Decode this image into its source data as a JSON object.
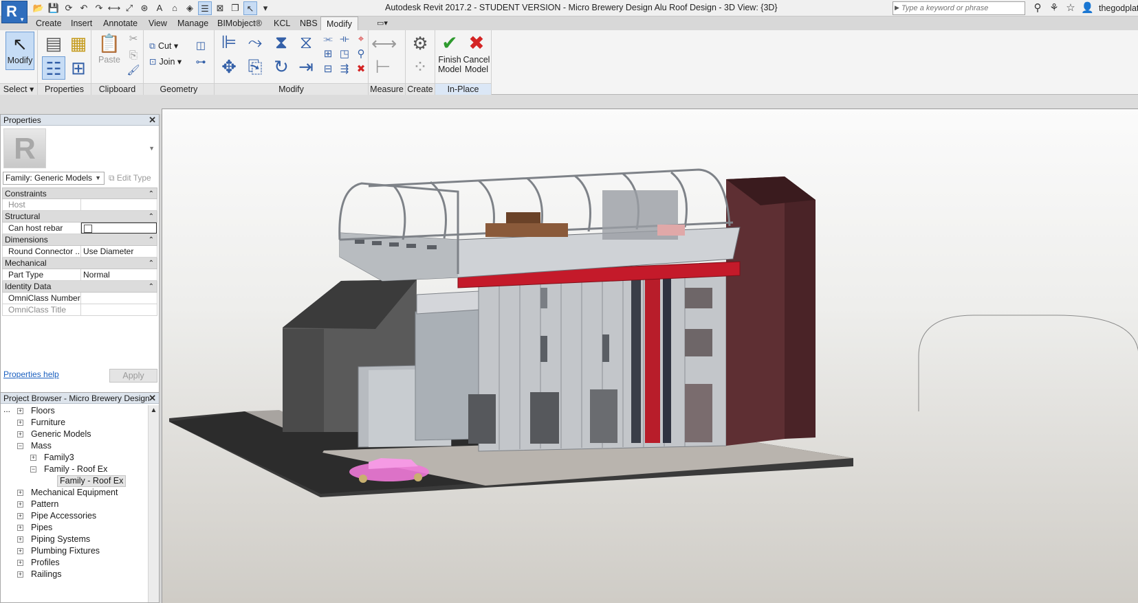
{
  "app": {
    "logo_letter": "R",
    "window_title": "Autodesk Revit 2017.2 - STUDENT VERSION -    Micro Brewery Design Alu Roof Design - 3D View: {3D}",
    "search_placeholder": "Type a keyword or phrase",
    "username": "thegodplato"
  },
  "ribbon": {
    "tabs": [
      "Create",
      "Insert",
      "Annotate",
      "View",
      "Manage",
      "BIMobject®",
      "KCL",
      "NBS",
      "Modify"
    ],
    "active_tab": "Modify",
    "panels": {
      "select": "Select",
      "properties": "Properties",
      "clipboard": "Clipboard",
      "geometry": "Geometry",
      "modify": "Modify",
      "measure": "Measure",
      "create": "Create",
      "inplace": "In-Place Editor"
    },
    "buttons": {
      "modify": "Modify",
      "paste": "Paste",
      "cut": "Cut",
      "join": "Join",
      "finish_model_1": "Finish",
      "finish_model_2": "Model",
      "cancel_model_1": "Cancel",
      "cancel_model_2": "Model"
    }
  },
  "properties": {
    "title": "Properties",
    "type_thumb_letter": "R",
    "family_selector": "Family: Generic Models",
    "edit_type": "Edit Type",
    "categories": [
      {
        "name": "Constraints",
        "rows": [
          {
            "key": "Host",
            "value": "",
            "disabled": true
          }
        ]
      },
      {
        "name": "Structural",
        "rows": [
          {
            "key": "Can host rebar",
            "value": "",
            "checkbox": true
          }
        ]
      },
      {
        "name": "Dimensions",
        "rows": [
          {
            "key": "Round Connector ...",
            "value": "Use Diameter"
          }
        ]
      },
      {
        "name": "Mechanical",
        "rows": [
          {
            "key": "Part Type",
            "value": "Normal"
          }
        ]
      },
      {
        "name": "Identity Data",
        "rows": [
          {
            "key": "OmniClass Number",
            "value": ""
          },
          {
            "key": "OmniClass Title",
            "value": "",
            "disabled": true
          }
        ]
      }
    ],
    "help_link": "Properties help",
    "apply": "Apply"
  },
  "browser": {
    "title": "Project Browser - Micro Brewery Design ...",
    "items": [
      {
        "label": "Floors",
        "level": 0,
        "toggle": "+"
      },
      {
        "label": "Furniture",
        "level": 0,
        "toggle": "+"
      },
      {
        "label": "Generic Models",
        "level": 0,
        "toggle": "+"
      },
      {
        "label": "Mass",
        "level": 0,
        "toggle": "-"
      },
      {
        "label": "Family3",
        "level": 1,
        "toggle": "+"
      },
      {
        "label": "Family - Roof Ex",
        "level": 1,
        "toggle": "-"
      },
      {
        "label": "Family - Roof Ex",
        "level": 2,
        "toggle": "",
        "selected": true
      },
      {
        "label": "Mechanical Equipment",
        "level": 0,
        "toggle": "+"
      },
      {
        "label": "Pattern",
        "level": 0,
        "toggle": "+"
      },
      {
        "label": "Pipe Accessories",
        "level": 0,
        "toggle": "+"
      },
      {
        "label": "Pipes",
        "level": 0,
        "toggle": "+"
      },
      {
        "label": "Piping Systems",
        "level": 0,
        "toggle": "+"
      },
      {
        "label": "Plumbing Fixtures",
        "level": 0,
        "toggle": "+"
      },
      {
        "label": "Profiles",
        "level": 0,
        "toggle": "+"
      },
      {
        "label": "Railings",
        "level": 0,
        "toggle": "+"
      }
    ]
  },
  "colors": {
    "accent_blue": "#2f6ebd",
    "finish_green": "#2e9a2e",
    "cancel_red": "#d42424",
    "banner_red": "#c41a2a",
    "brick": "#5a2a2e"
  }
}
